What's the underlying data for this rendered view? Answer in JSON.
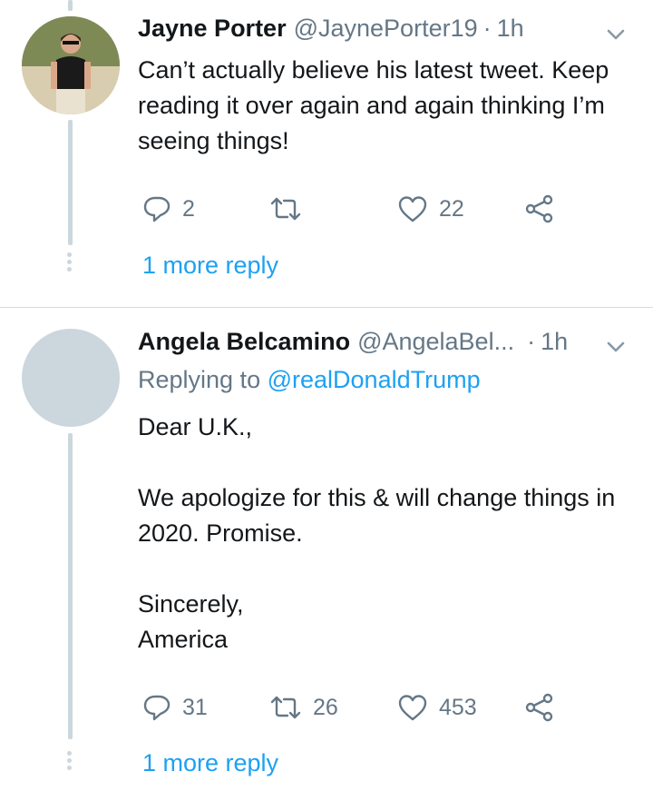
{
  "tweets": [
    {
      "name": "Jayne Porter",
      "handle": "@JaynePorter19",
      "separator": "·",
      "time": "1h",
      "text": "Can’t actually believe his latest tweet. Keep reading it over again and again thinking I’m seeing things!",
      "replies": "2",
      "retweets": "",
      "likes": "22",
      "more_reply": "1 more reply"
    },
    {
      "name": "Angela Belcamino",
      "handle": "@AngelaBel...",
      "separator": "·",
      "time": "1h",
      "replying_prefix": "Replying to",
      "replying_to": "@realDonaldTrump",
      "text": "Dear U.K.,\n\nWe apologize for this & will change things in 2020. Promise.\n\nSincerely,\nAmerica",
      "replies": "31",
      "retweets": "26",
      "likes": "453",
      "more_reply": "1 more reply"
    }
  ],
  "icons": {
    "reply": "reply-icon",
    "retweet": "retweet-icon",
    "like": "heart-icon",
    "share": "share-icon",
    "menu": "chevron-down-icon"
  },
  "colors": {
    "link": "#1da1f2",
    "secondary": "#657786",
    "thread": "#ccd6dd"
  }
}
